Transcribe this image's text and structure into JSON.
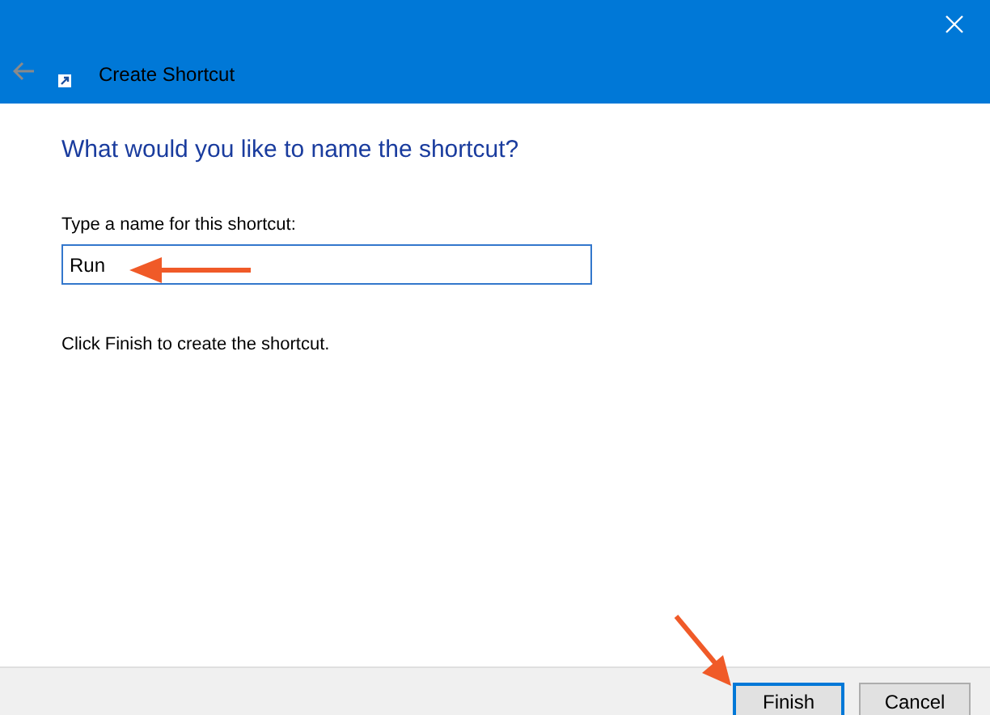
{
  "window": {
    "title": "Create Shortcut",
    "back_disabled": true
  },
  "heading": "What would you like to name the shortcut?",
  "name_field": {
    "label": "Type a name for this shortcut:",
    "value": "Run"
  },
  "instruction": "Click Finish to create the shortcut.",
  "buttons": [
    {
      "label": "Finish",
      "default": true
    },
    {
      "label": "Cancel",
      "default": false
    }
  ]
}
